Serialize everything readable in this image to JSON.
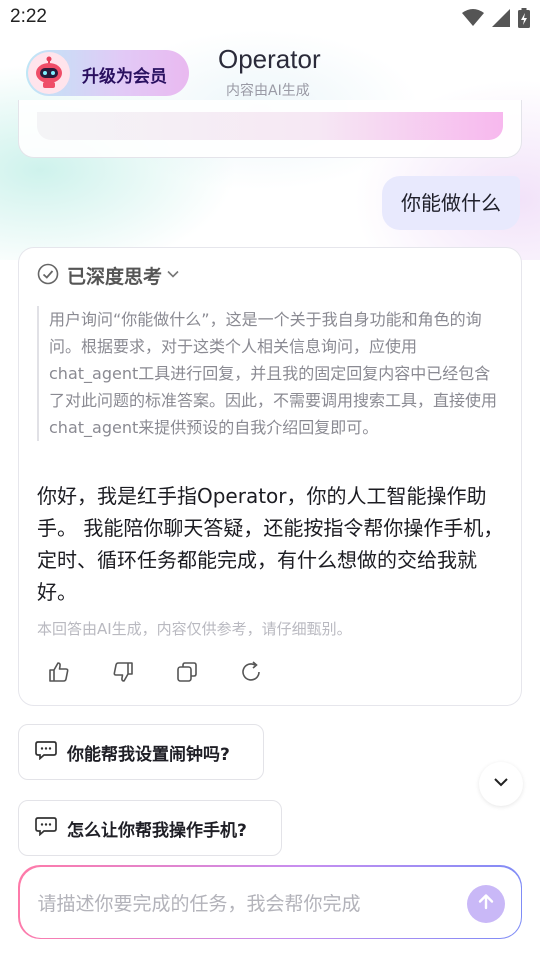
{
  "status_bar": {
    "time": "2:22",
    "icons": [
      "wifi-icon",
      "signal-icon",
      "battery-charging-icon"
    ]
  },
  "header": {
    "vip_label": "升级为会员",
    "title": "Operator",
    "subtitle": "内容由AI生成"
  },
  "conversation": {
    "user_message": "你能做什么",
    "thinking": {
      "title": "已深度思考",
      "content": "用户询问“你能做什么”，这是一个关于我自身功能和角色的询问。根据要求，对于这类个人相关信息询问，应使用chat_agent工具进行回复，并且我的固定回复内容中已经包含了对此问题的标准答案。因此，不需要调用搜索工具，直接使用chat_agent来提供预设的自我介绍回复即可。"
    },
    "answer": "你好，我是红手指Operator，你的人工智能操作助手。 我能陪你聊天答疑，还能按指令帮你操作手机，定时、循环任务都能完成，有什么想做的交给我就好。",
    "disclaimer": "本回答由AI生成，内容仅供参考，请仔细甄别。",
    "actions": [
      "thumbs-up-icon",
      "thumbs-down-icon",
      "copy-icon",
      "regenerate-icon"
    ]
  },
  "suggestions": [
    {
      "text": "你能帮我设置闹钟吗?"
    },
    {
      "text": "怎么让你帮我操作手机?"
    }
  ],
  "input": {
    "placeholder": "请描述你要完成的任务，我会帮你完成",
    "value": ""
  },
  "colors": {
    "user_bubble": "#e8e9fd",
    "send_button": "#c9b8f7",
    "accent_gradient_start": "#ff7aa8",
    "accent_gradient_end": "#7d8cf6"
  }
}
